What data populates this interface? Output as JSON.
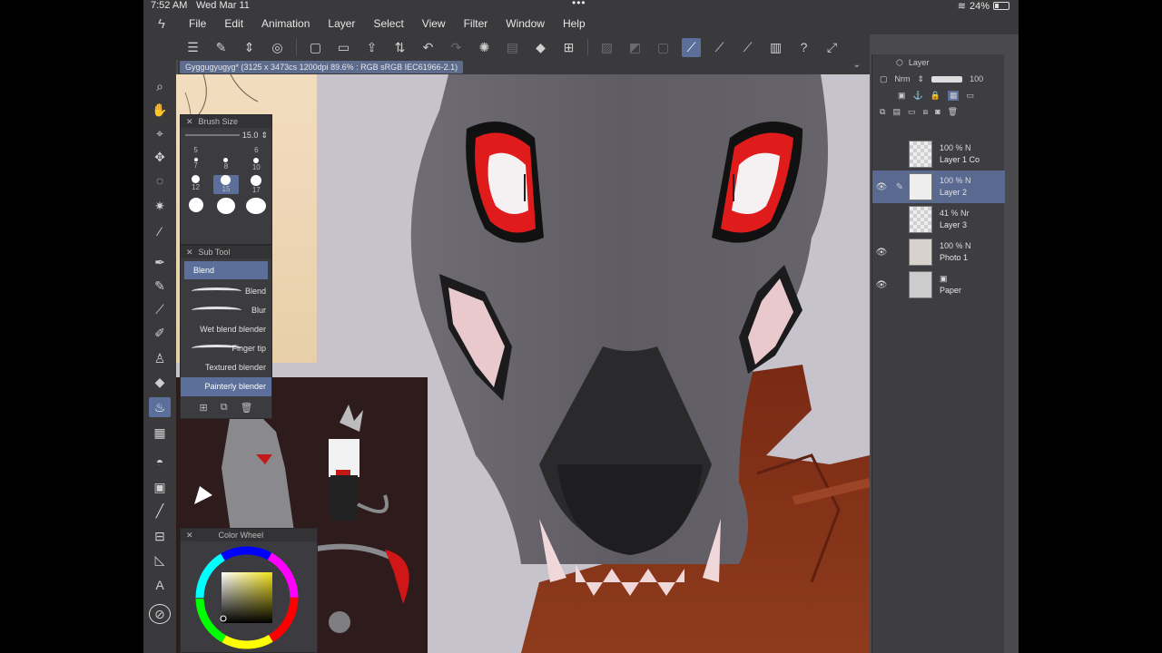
{
  "status_bar": {
    "time": "7:52 AM",
    "date": "Wed Mar 11",
    "battery": "24%"
  },
  "menu": {
    "items": [
      "File",
      "Edit",
      "Animation",
      "Layer",
      "Select",
      "View",
      "Filter",
      "Window",
      "Help"
    ]
  },
  "document_tab": {
    "title": "Gyggugyugyg* (3125 x 3473cs 1200dpi 89.6% : RGB sRGB IEC61966-2.1)"
  },
  "brush_size": {
    "title": "Brush Size",
    "value": "15.0",
    "rows": [
      [
        "5",
        "",
        "6"
      ],
      [
        "7",
        "8",
        "10"
      ],
      [
        "12",
        "15",
        "17"
      ]
    ],
    "selected": "15"
  },
  "sub_tool": {
    "title": "Sub Tool",
    "group": "Blend",
    "items": [
      "Blend",
      "Blur",
      "Wet blend blender",
      "Finger tip",
      "Textured blender",
      "Painterly blender"
    ],
    "selected": "Painterly blender"
  },
  "color_wheel": {
    "title": "Color Wheel",
    "main_color": "#f2e21c"
  },
  "layer_panel": {
    "title": "Layer",
    "blend_mode": "Nrm",
    "opacity": "100",
    "layers": [
      {
        "opacity": "100 % N",
        "name": "Layer 1 Co",
        "visible": false,
        "selected": false
      },
      {
        "opacity": "100 % N",
        "name": "Layer 2",
        "visible": true,
        "selected": true
      },
      {
        "opacity": "41 % Nr",
        "name": "Layer 3",
        "visible": false,
        "selected": false
      },
      {
        "opacity": "100 % N",
        "name": "Photo 1",
        "visible": true,
        "selected": false
      },
      {
        "opacity": "",
        "name": "Paper",
        "visible": true,
        "selected": false
      }
    ]
  },
  "colors": {
    "accent": "#5b6f9a",
    "eye_red": "#e01b1b",
    "fur_gray": "#6c6a70",
    "background": "#c7c3cc"
  }
}
